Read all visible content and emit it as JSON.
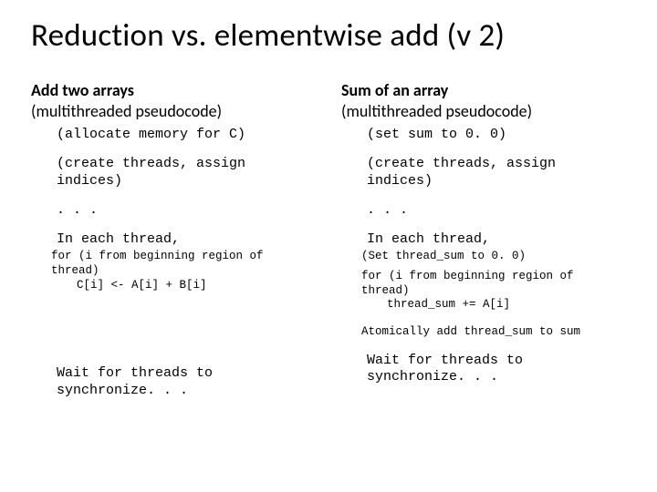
{
  "title": "Reduction vs. elementwise add (v 2)",
  "left": {
    "head_bold": "Add two arrays",
    "head_rest": "(multithreaded pseudocode)",
    "l1": "(allocate memory for C)",
    "l2a": "(create threads, assign",
    "l2b": "indices)",
    "dots": ". . .",
    "each": "In each thread,",
    "for1": "for (i from beginning region of",
    "for2": "thread)",
    "assign": "C[i] <- A[i] + B[i]",
    "wait1": "Wait for threads to",
    "wait2": "synchronize. . ."
  },
  "right": {
    "head_bold": "Sum of an array",
    "head_rest": "(multithreaded pseudocode)",
    "l1": "(set sum to 0. 0)",
    "l2a": "(create threads, assign",
    "l2b": "indices)",
    "dots": ". . .",
    "each": "In each thread,",
    "set0": "(Set thread_sum to 0. 0)",
    "for1": "for (i from beginning region of",
    "for2": "thread)",
    "assign": "thread_sum += A[i]",
    "atomic": "Atomically add thread_sum to sum",
    "wait1": "Wait for threads to",
    "wait2": "synchronize. . ."
  }
}
